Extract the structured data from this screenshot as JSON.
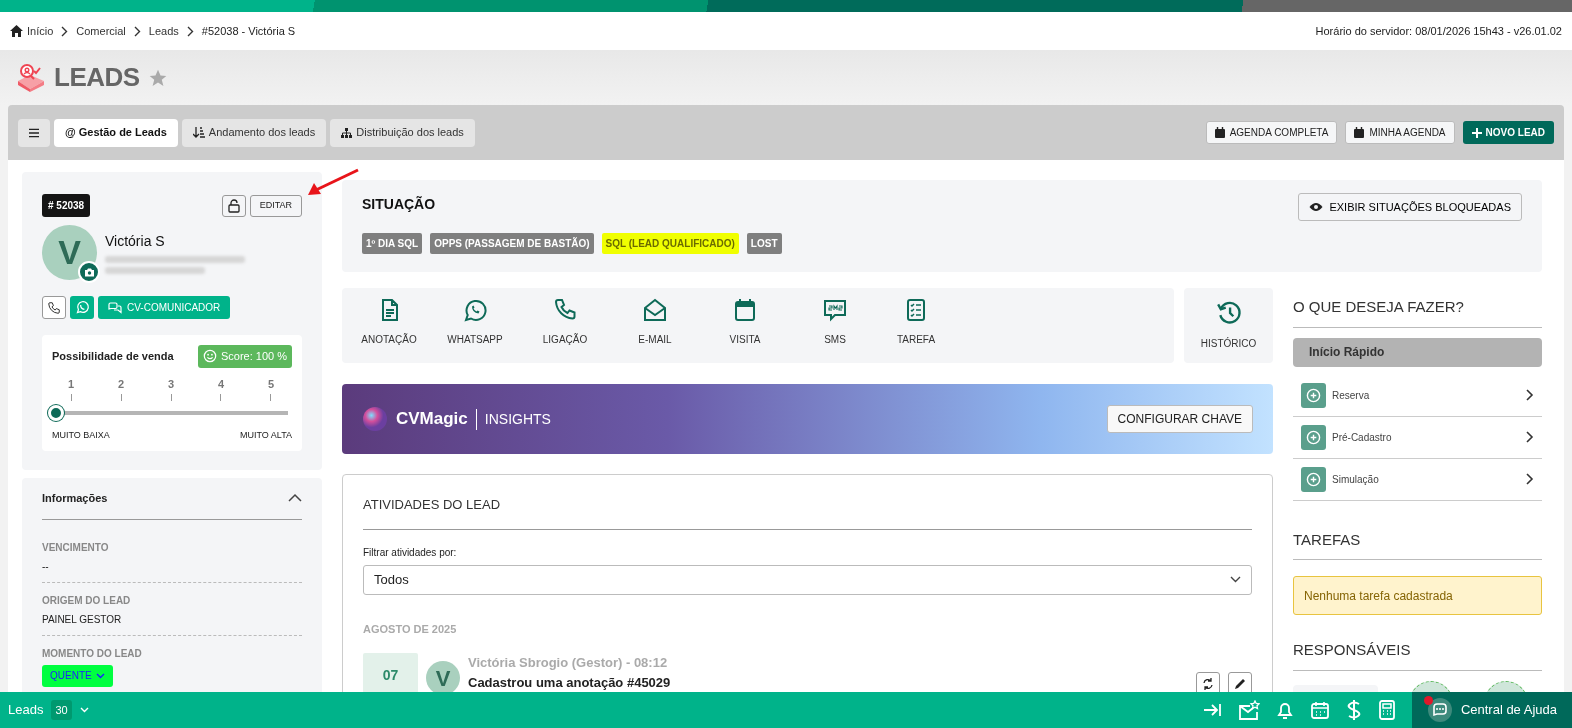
{
  "breadcrumb": [
    {
      "label": "Início",
      "kind": "home"
    },
    {
      "label": "Comercial",
      "kind": "link"
    },
    {
      "label": "Leads",
      "kind": "link"
    },
    {
      "label": "#52038 - Victória S",
      "kind": "current"
    }
  ],
  "server_time": "Horário do servidor: 08/01/2026 15h43 - v26.01.02",
  "page_title": "LEADS",
  "favorite": false,
  "tabs": [
    {
      "label": "@ Gestão de Leads",
      "selected": true
    },
    {
      "label": "Andamento dos leads",
      "selected": false
    },
    {
      "label": "Distribuição dos leads",
      "selected": false
    }
  ],
  "toolbar_buttons": [
    {
      "label": "AGENDA COMPLETA",
      "kind": "outline"
    },
    {
      "label": "MINHA AGENDA",
      "kind": "outline"
    },
    {
      "label": "NOVO LEAD",
      "kind": "primary"
    }
  ],
  "lead": {
    "id": "# 52038",
    "locked": false,
    "edit_button": "EDITAR",
    "avatar_initial": "V",
    "name": "Victória S",
    "contact_button": "CV-COMUNICADOR"
  },
  "sale_chance": {
    "title": "Possibilidade de venda",
    "score": "Score: 100 %",
    "ticks": [
      "1",
      "2",
      "3",
      "4",
      "5"
    ],
    "level": 0,
    "min_label": "MUITO BAIXA",
    "max_label": "MUITO ALTA"
  },
  "info": {
    "title": "Informações",
    "expanded": true,
    "fields": [
      {
        "label": "VENCIMENTO",
        "value": "--",
        "kind": "text"
      },
      {
        "label": "ORIGEM DO LEAD",
        "value": "PAINEL GESTOR",
        "kind": "text"
      },
      {
        "label": "MOMENTO DO LEAD",
        "value": "QUENTE",
        "kind": "dropdown"
      }
    ]
  },
  "situation": {
    "title": "SITUAÇÃO",
    "button": "EXIBIR SITUAÇÕES BLOQUEADAS",
    "tags": [
      {
        "label": "1º DIA SQL",
        "color": "#7f7f7f"
      },
      {
        "label": "OPPS (PASSAGEM DE BASTÃO)",
        "color": "#7f7f7f"
      },
      {
        "label": "SQL (LEAD QUALIFICADO)",
        "color": "#f0ff00"
      },
      {
        "label": "LOST",
        "color": "#7f7f7f"
      }
    ]
  },
  "actions": [
    "ANOTAÇÃO",
    "WHATSAPP",
    "LIGAÇÃO",
    "E-MAIL",
    "VISITA",
    "SMS",
    "TAREFA"
  ],
  "history": "HISTÓRICO",
  "cvmagic": {
    "brand": "CVMagic",
    "section": "INSIGHTS",
    "button": "CONFIGURAR CHAVE"
  },
  "activities": {
    "title": "ATIVIDADES DO LEAD",
    "filter_label": "Filtrar atividades por:",
    "filter_value": "Todos",
    "month": "AGOSTO DE 2025",
    "items": [
      {
        "day": "07",
        "avatar_initial": "V",
        "author": "Victória Sbrogio (Gestor) - 08:12",
        "text": "Cadastrou uma anotação #45029"
      }
    ]
  },
  "quick": {
    "title": "O QUE DESEJA FAZER?",
    "header": "Início Rápido",
    "items": [
      "Reserva",
      "Pré-Cadastro",
      "Simulação"
    ]
  },
  "tasks": {
    "title": "TAREFAS",
    "empty": "Nenhuma tarefa cadastrada"
  },
  "responsibles": {
    "title": "RESPONSÁVEIS"
  },
  "bottom_bar": {
    "module": "Leads",
    "count": "30",
    "help": "Central de Ajuda",
    "help_notification": true
  }
}
